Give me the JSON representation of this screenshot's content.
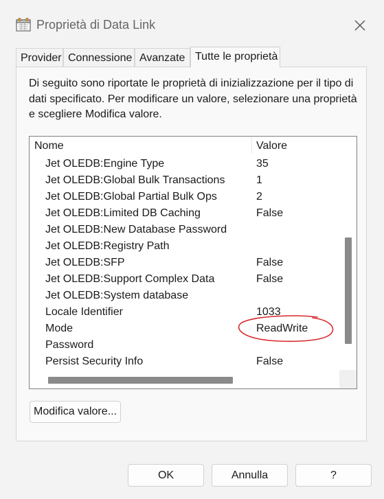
{
  "window": {
    "title": "Proprietà di Data Link"
  },
  "tabs": [
    {
      "label": "Provider",
      "active": false
    },
    {
      "label": "Connessione",
      "active": false
    },
    {
      "label": "Avanzate",
      "active": false
    },
    {
      "label": "Tutte le proprietà",
      "active": true
    }
  ],
  "description": "Di seguito sono riportate le proprietà di inizializzazione per il tipo di dati specificato. Per modificare un valore, selezionare una proprietà e scegliere Modifica valore.",
  "grid": {
    "columns": {
      "name": "Nome",
      "value": "Valore"
    },
    "rows": [
      {
        "name": "Jet OLEDB:Engine Type",
        "value": "35"
      },
      {
        "name": "Jet OLEDB:Global Bulk Transactions",
        "value": "1"
      },
      {
        "name": "Jet OLEDB:Global Partial Bulk Ops",
        "value": "2"
      },
      {
        "name": "Jet OLEDB:Limited DB Caching",
        "value": "False"
      },
      {
        "name": "Jet OLEDB:New Database Password",
        "value": ""
      },
      {
        "name": "Jet OLEDB:Registry Path",
        "value": ""
      },
      {
        "name": "Jet OLEDB:SFP",
        "value": "False"
      },
      {
        "name": "Jet OLEDB:Support Complex Data",
        "value": "False"
      },
      {
        "name": "Jet OLEDB:System database",
        "value": ""
      },
      {
        "name": "Locale Identifier",
        "value": "1033"
      },
      {
        "name": "Mode",
        "value": "ReadWrite"
      },
      {
        "name": "Password",
        "value": ""
      },
      {
        "name": "Persist Security Info",
        "value": "False"
      }
    ]
  },
  "buttons": {
    "edit_value": "Modifica valore...",
    "ok": "OK",
    "cancel": "Annulla",
    "help": "?"
  },
  "icons": {
    "app": "data-link-icon",
    "close": "close-icon"
  },
  "colors": {
    "annotation": "#d9262b",
    "scroll_thumb": "#8a8a8a"
  }
}
